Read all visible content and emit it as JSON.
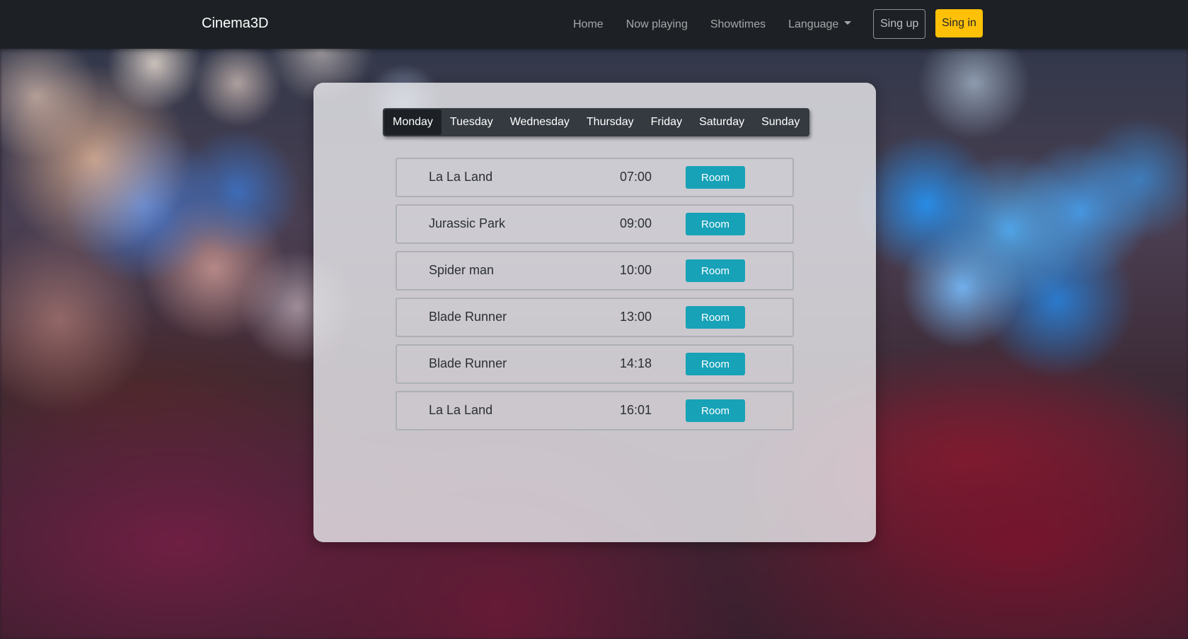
{
  "navbar": {
    "brand": "Cinema3D",
    "links": [
      {
        "label": "Home"
      },
      {
        "label": "Now playing"
      },
      {
        "label": "Showtimes"
      },
      {
        "label": "Language",
        "dropdown": true
      }
    ],
    "signup_label": "Sing up",
    "signin_label": "Sing in"
  },
  "days": [
    "Monday",
    "Tuesday",
    "Wednesday",
    "Thursday",
    "Friday",
    "Saturday",
    "Sunday"
  ],
  "selected_day": "Monday",
  "showtimes": [
    {
      "title": "La La Land",
      "time": "07:00",
      "button": "Room"
    },
    {
      "title": "Jurassic Park",
      "time": "09:00",
      "button": "Room"
    },
    {
      "title": "Spider man",
      "time": "10:00",
      "button": "Room"
    },
    {
      "title": "Blade Runner",
      "time": "13:00",
      "button": "Room"
    },
    {
      "title": "Blade Runner",
      "time": "14:18",
      "button": "Room"
    },
    {
      "title": "La La Land",
      "time": "16:01",
      "button": "Room"
    }
  ],
  "colors": {
    "navbar_bg": "#1d2125",
    "signin_bg": "#ffc107",
    "room_button_bg": "#17a2b8",
    "tabs_bg": "#343a40"
  }
}
